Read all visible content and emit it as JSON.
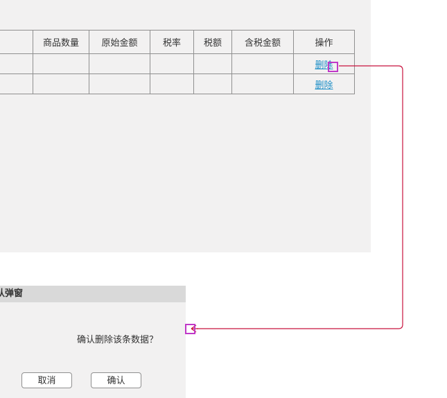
{
  "table": {
    "headers": [
      "",
      "商品数量",
      "原始金额",
      "税率",
      "税额",
      "含税金额",
      "操作"
    ],
    "rows": [
      {
        "action": "删除"
      },
      {
        "action": "删除"
      }
    ]
  },
  "dialog": {
    "title_partial": "认弹窗",
    "message": "确认删除该条数据？",
    "cancel_label": "取消",
    "confirm_label": "确认"
  },
  "colors": {
    "annotation_line": "#c8103c",
    "marker": "#c038c8",
    "link": "#1e8fc7",
    "panel_bg": "#f2f1f1",
    "dialog_header_bg": "#d9d9d9"
  }
}
